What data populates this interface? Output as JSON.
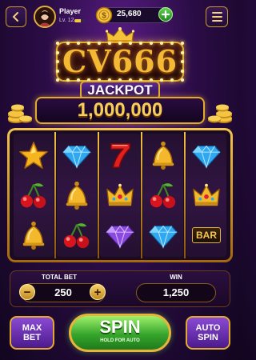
{
  "player": {
    "name": "Player",
    "level": "Lv. 12",
    "level_progress": 0.55
  },
  "wallet": {
    "balance": "25,680"
  },
  "logo": {
    "title": "CV666"
  },
  "jackpot": {
    "label": "JACKPOT",
    "amount": "1,000,000"
  },
  "reels": [
    [
      "star",
      "cherry",
      "bell"
    ],
    [
      "diamond-blue",
      "bell",
      "cherry"
    ],
    [
      "seven",
      "crown",
      "diamond-purple"
    ],
    [
      "bell",
      "cherry",
      "diamond-blue"
    ],
    [
      "diamond-blue",
      "crown",
      "bar"
    ]
  ],
  "symbol_text": {
    "bar": "BAR"
  },
  "bet": {
    "label": "TOTAL BET",
    "value": "250",
    "minus": "−",
    "plus": "+"
  },
  "win": {
    "label": "WIN",
    "value": "1,250"
  },
  "buttons": {
    "max_bet": "MAX\nBET",
    "spin": "SPIN",
    "spin_sub": "HOLD FOR AUTO",
    "auto_spin": "AUTO\nSPIN"
  },
  "colors": {
    "gold": "#e2aa2c",
    "purple": "#2a0c45",
    "green": "#36a52c"
  }
}
